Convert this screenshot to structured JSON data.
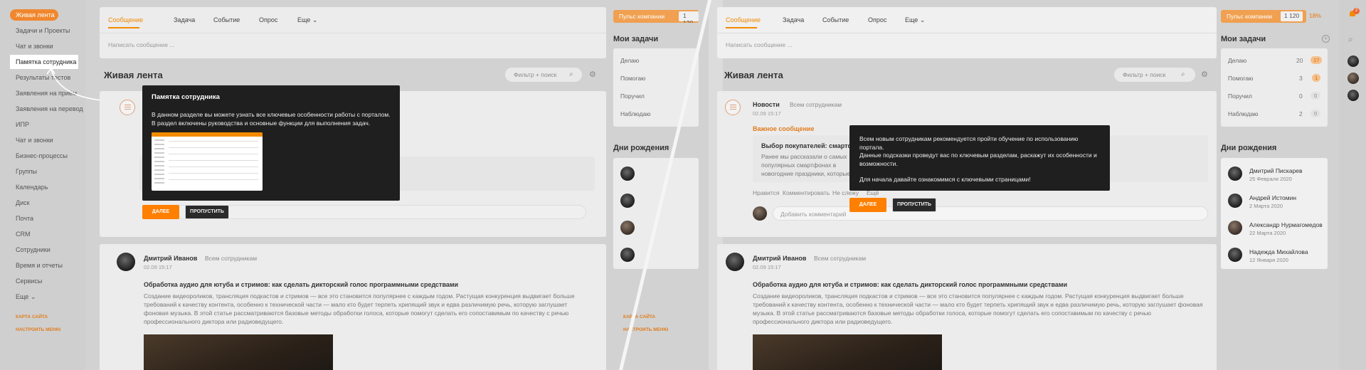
{
  "left_menu": {
    "active": "Живая лента",
    "items": [
      "Задачи и Проекты",
      "Чат и звонки",
      "Памятка сотрудника",
      "Результаты тестов",
      "Заявления на приём",
      "Заявления на перевод",
      "ИПР",
      "Чат и звонки",
      "Бизнес-процессы",
      "Группы",
      "Календарь",
      "Диск",
      "Почта",
      "CRM",
      "Сотрудники",
      "Время и отчеты",
      "Сервисы",
      "Еще ⌄"
    ],
    "map": "КАРТА САЙТА",
    "settings": "НАСТРОИТЬ МЕНЮ"
  },
  "compose": {
    "tabs": [
      "Сообщение",
      "Задача",
      "Событие",
      "Опрос",
      "Еще ⌄"
    ],
    "placeholder": "Написать сообщение ..."
  },
  "feed": {
    "title": "Живая лента",
    "filter": "Фильтр + поиск"
  },
  "pulse": {
    "label": "Пульс компании",
    "value": "1 120",
    "pct": "18%"
  },
  "tasks": {
    "title": "Мои задачи",
    "rows": [
      {
        "label": "Делаю",
        "count": "20",
        "badge": "17"
      },
      {
        "label": "Помогаю",
        "count": "3",
        "badge": "1"
      },
      {
        "label": "Поручил",
        "count": "0",
        "badge": "0"
      },
      {
        "label": "Наблюдаю",
        "count": "2",
        "badge": "0"
      }
    ]
  },
  "birthdays": {
    "title": "Дни рождения",
    "people": [
      {
        "name": "Дмитрий Пискарев",
        "date": "25 Февраля 2020"
      },
      {
        "name": "Андрей Истомин",
        "date": "2 Марта 2020"
      },
      {
        "name": "Александр Нурмагомедов",
        "date": "22 Марта 2020"
      },
      {
        "name": "Надежда Михайлова",
        "date": "12 Января 2020"
      }
    ]
  },
  "post1": {
    "category": "Новости",
    "dest": "Всем сотрудникам",
    "time": "02.09 15:17",
    "important": "Важное сообщение",
    "title": "Выбор покупателей: смартфоны, которые чаще всего дарили на новогодние праздники. Часть II",
    "text": "Ранее мы рассказали о самых популярных смартфонах в новогодние праздники, которые заняли в нашем рейтинге с 20 по 11 место. Подошло время к самому интересному — познакомимся с лидерами рейтинга.",
    "actions": [
      "Нравится",
      "Комментировать",
      "Не слежу",
      "Ещё"
    ],
    "comment_placeholder": "Добавить комментарий"
  },
  "post2": {
    "author": "Дмитрий Иванов",
    "dest": "Всем сотрудникам",
    "time": "02.09 15:17",
    "title": "Обработка аудио для ютуба и стримов: как сделать дикторский голос программными средствами",
    "text": "Создание видеороликов, трансляция подкастов и стримов — все это становится популярнее с каждым годом. Растущая конкуренция выдвигает больше требований к качеству контента, особенно к технической части — мало кто будет терпеть хрипящий звук и едва различимую речь, которую заглушает фоновая музыка. В этой статье рассматриваются базовые методы обработки голоса, которые помогут сделать его сопоставимым по качеству с речью профессионального диктора или радиоведущего."
  },
  "popup_left": {
    "title": "Памятка сотрудника",
    "text": "В данном разделе вы можете узнать все ключевые особенности работы с порталом. В раздел включены руководства и основные функции для выполнения задач.",
    "next": "ДАЛЕЕ",
    "skip": "ПРОПУСТИТЬ"
  },
  "popup_right": {
    "p1": "Всем новым сотрудникам рекомендуется пройти обучение по использованию портала.",
    "p2": "Данные подсказки проведут вас по ключевым разделам, раскажут их особенности и возможности.",
    "p3": "Для начала давайте ознакомимся с ключевыми страницами!",
    "next": "ДАЛЕЕ",
    "skip": "ПРОПУСТИТЬ"
  },
  "misc": {
    "notif": "2",
    "accent": "#f38a00"
  }
}
